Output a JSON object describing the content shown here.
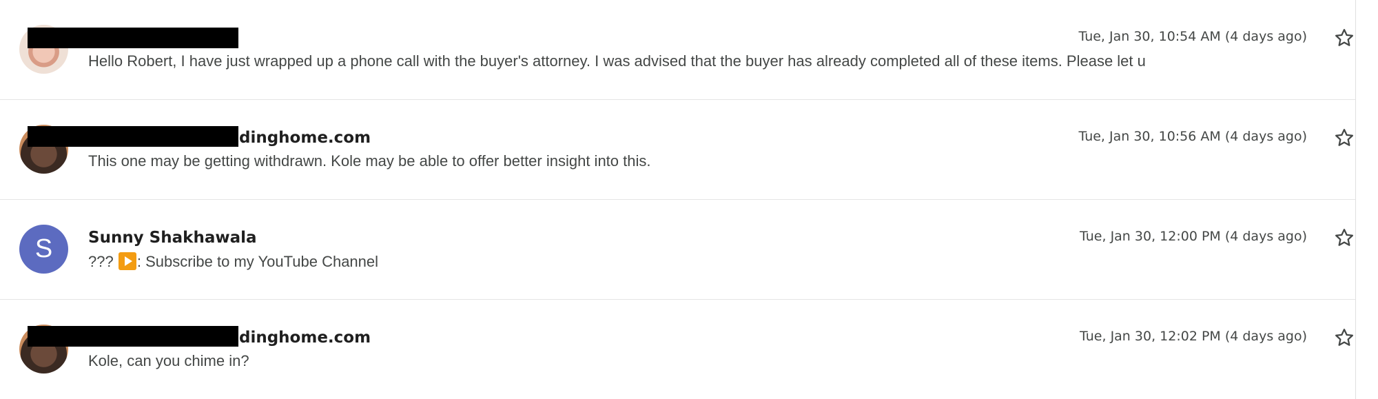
{
  "messages": [
    {
      "sender": "",
      "time": "Tue, Jan 30, 10:54 AM (4 days ago)",
      "snippet": "Hello Robert, I have just wrapped up a phone call with the buyer's attorney. I was advised that the buyer has already completed all of these items. Please let u",
      "avatar": "photo"
    },
    {
      "sender": "dinghome.com",
      "time": "Tue, Jan 30, 10:56 AM (4 days ago)",
      "snippet": "This one may be getting withdrawn. Kole may be able to offer better insight into this.",
      "avatar": "photo"
    },
    {
      "sender": "Sunny Shakhawala",
      "time": "Tue, Jan 30, 12:00 PM (4 days ago)",
      "snippet_prefix": "???",
      "snippet_suffix": ": Subscribe to my YouTube Channel",
      "avatar_letter": "S",
      "avatar_color": "#5c6bc0"
    },
    {
      "sender": "dinghome.com",
      "time": "Tue, Jan 30, 12:02 PM (4 days ago)",
      "snippet": "Kole, can you chime in?",
      "avatar": "photo"
    }
  ],
  "icons": {
    "star": "star-outline-icon",
    "play": "play-button-icon"
  }
}
